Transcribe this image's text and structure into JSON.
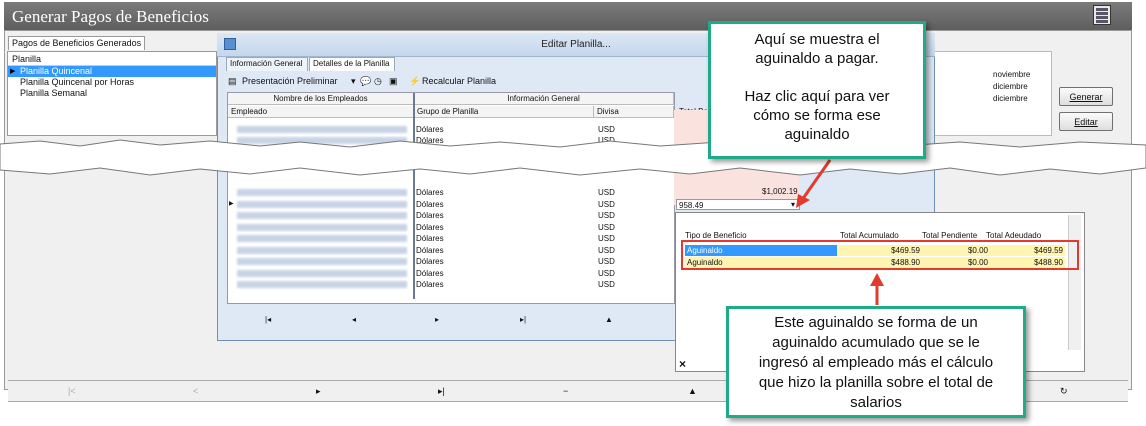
{
  "main_window": {
    "title": "Generar Pagos de Beneficios",
    "tab": "Pagos de Beneficios Generados",
    "list_header": "Planilla",
    "planillas": [
      "Planilla Quincenal",
      "Planilla Quincenal por Horas",
      "Planilla Semanal"
    ],
    "months": [
      "noviembre",
      "diciembre",
      "diciembre"
    ],
    "generar_label": "Generar",
    "editar_label": "Editar",
    "bottom_nav": [
      "|<",
      "<",
      "▸",
      "▸|",
      "−",
      "▲",
      "↻"
    ]
  },
  "editor": {
    "title": "Editar Planilla...",
    "tabs": [
      "Información General",
      "Detalles de la Planilla"
    ],
    "toolbar": {
      "preview": "Presentación Preliminar",
      "recalc": "Recalcular Planilla"
    },
    "group_headers": {
      "names": "Nombre de los Empleados",
      "info": "Información General"
    },
    "columns": {
      "empleado": "Empleado",
      "grupo": "Grupo de Planilla",
      "divisa": "Divisa",
      "total": "Total Be"
    },
    "rows": [
      {
        "grupo": "Dólares",
        "divisa": "USD"
      },
      {
        "grupo": "Dólares",
        "divisa": "USD"
      },
      {
        "grupo": "Dólares",
        "divisa": "USD"
      },
      {
        "grupo": "Dólares",
        "divisa": "USD"
      },
      {
        "grupo": "Dólares",
        "divisa": "USD"
      },
      {
        "grupo": "Dólares",
        "divisa": "USD"
      },
      {
        "grupo": "Dólares",
        "divisa": "USD"
      },
      {
        "grupo": "Dólares",
        "divisa": "USD"
      },
      {
        "grupo": "Dólares",
        "divisa": "USD"
      },
      {
        "grupo": "Dólares",
        "divisa": "USD"
      },
      {
        "grupo": "Dólares",
        "divisa": "USD"
      }
    ],
    "totals": [
      "$1,002.19",
      "958.49"
    ],
    "grid_nav": [
      "|◂",
      "◂",
      "▸",
      "▸|",
      "▲"
    ]
  },
  "popup": {
    "headers": [
      "Tipo de Beneficio",
      "Total Acumulado",
      "Total Pendiente",
      "Total Adeudado"
    ],
    "rows": [
      {
        "tipo": "Aguinaldo",
        "acumulado": "$469.59",
        "pendiente": "$0.00",
        "adeudado": "$469.59"
      },
      {
        "tipo": "Aguinaldo",
        "acumulado": "$488.90",
        "pendiente": "$0.00",
        "adeudado": "$488.90"
      }
    ],
    "close": "×"
  },
  "callouts": {
    "top": [
      "Aquí se muestra el",
      "aguinaldo a pagar.",
      "",
      "Haz clic aquí para ver",
      "cómo se forma ese",
      "aguinaldo"
    ],
    "bottom": [
      "Este aguinaldo se forma de un",
      "aguinaldo acumulado que se le",
      "ingresó al empleado más el cálculo",
      "que hizo la planilla sobre el total de",
      "salarios"
    ]
  },
  "colors": {
    "accent_teal": "#1faa88",
    "arrow_red": "#e23b2e",
    "highlight_yellow": "#fff5b1",
    "selection_blue": "#3399ff"
  }
}
